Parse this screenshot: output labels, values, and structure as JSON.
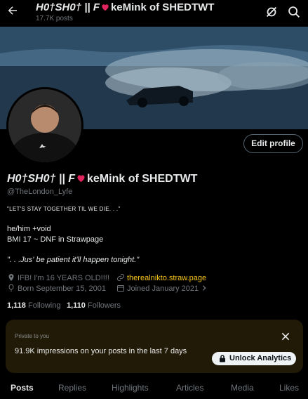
{
  "header": {
    "title_part1": "H0†SH0† || F",
    "title_part2": "keMink of SHEDTWT",
    "posts_count": "17.7K posts",
    "back_icon": "arrow-left-icon",
    "icons": [
      "grok-icon",
      "search-icon"
    ]
  },
  "profile": {
    "name_part1": "H0†SH0† || F",
    "name_part2": "keMink of SHEDTWT",
    "handle": "@TheLondon_Lyfe",
    "edit_label": "Edit profile",
    "bio": {
      "line1": "\"LET'S STAY TOGETHER TIL WE DIE. . .\"",
      "line2": "he/him +void",
      "line3": "BMI 17 ~ DNF in Strawpage",
      "line4": "\". . .Jus' be patient it'll happen tonight.\""
    },
    "location": "IFB! I'm 16 YEARS OLD!!!!",
    "website": "therealnikto.straw.page",
    "birthday": "Born September 15, 2001",
    "joined": "Joined January 2021",
    "following_count": "1,118",
    "following_label": "Following",
    "followers_count": "1,110",
    "followers_label": "Followers"
  },
  "analytics_card": {
    "private_label": "Private to you",
    "impressions_text": "91.9K impressions on your posts in the last 7 days",
    "unlock_label": "Unlock Analytics"
  },
  "tabs": [
    "Posts",
    "Replies",
    "Highlights",
    "Articles",
    "Media",
    "Likes"
  ],
  "colors": {
    "link": "#f5c518",
    "card_bg": "#211a06",
    "heart": "#e0245e"
  }
}
